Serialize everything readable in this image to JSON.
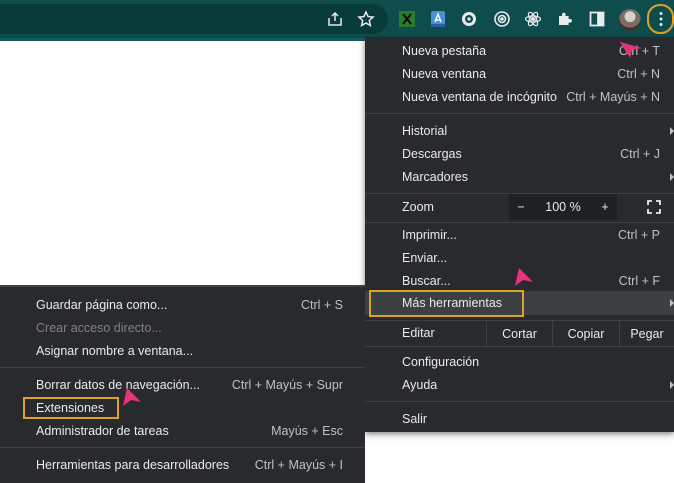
{
  "toolbar": {
    "icons": [
      "share-icon",
      "star-icon",
      "extension-x-icon",
      "extension-a-icon",
      "extension-gear-icon",
      "extension-target-icon",
      "react-icon",
      "puzzle-icon",
      "sidepanel-icon",
      "avatar",
      "more-vert-icon"
    ],
    "accent_color": "#0f4d4d",
    "highlight_color": "#e0a321"
  },
  "menu": {
    "new_tab": {
      "label": "Nueva pestaña",
      "shortcut": "Ctrl + T"
    },
    "new_window": {
      "label": "Nueva ventana",
      "shortcut": "Ctrl + N"
    },
    "new_incognito": {
      "label": "Nueva ventana de incógnito",
      "shortcut": "Ctrl + Mayús + N"
    },
    "history": {
      "label": "Historial"
    },
    "downloads": {
      "label": "Descargas",
      "shortcut": "Ctrl + J"
    },
    "bookmarks": {
      "label": "Marcadores"
    },
    "zoom": {
      "label": "Zoom",
      "minus": "−",
      "value": "100 %",
      "plus": "+"
    },
    "print": {
      "label": "Imprimir...",
      "shortcut": "Ctrl + P"
    },
    "cast": {
      "label": "Enviar..."
    },
    "find": {
      "label": "Buscar...",
      "shortcut": "Ctrl + F"
    },
    "more_tools": {
      "label": "Más herramientas"
    },
    "edit": {
      "label": "Editar",
      "cut": "Cortar",
      "copy": "Copiar",
      "paste": "Pegar"
    },
    "settings": {
      "label": "Configuración"
    },
    "help": {
      "label": "Ayuda"
    },
    "exit": {
      "label": "Salir"
    }
  },
  "submenu": {
    "save_page": {
      "label": "Guardar página como...",
      "shortcut": "Ctrl + S"
    },
    "create_shortcut": {
      "label": "Crear acceso directo..."
    },
    "name_window": {
      "label": "Asignar nombre a ventana..."
    },
    "clear_data": {
      "label": "Borrar datos de navegación...",
      "shortcut": "Ctrl + Mayús + Supr"
    },
    "extensions": {
      "label": "Extensiones"
    },
    "task_manager": {
      "label": "Administrador de tareas",
      "shortcut": "Mayús + Esc"
    },
    "dev_tools": {
      "label": "Herramientas para desarrolladores",
      "shortcut": "Ctrl + Mayús + I"
    }
  }
}
